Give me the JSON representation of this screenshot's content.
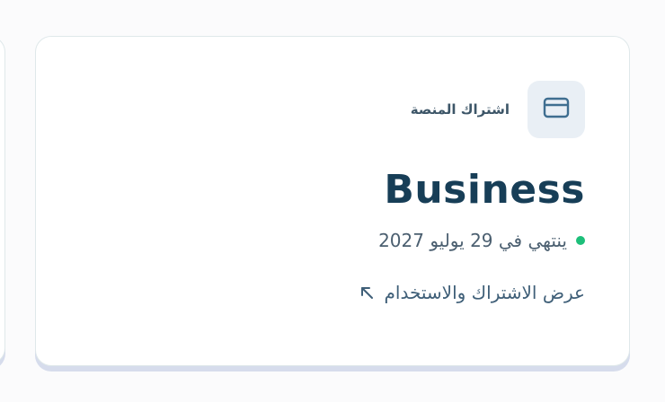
{
  "card": {
    "kicker": "اشتراك المنصة",
    "plan_name": "Business",
    "status_text": "ينتهي في 29 يوليو 2027",
    "status_color": "#1dbf7a",
    "link_text": "عرض الاشتراك والاستخدام"
  },
  "icons": {
    "card_icon": "credit-card-icon",
    "link_icon": "arrow-up-left-icon"
  },
  "colors": {
    "accent": "#173e57",
    "icon_tile_bg": "#e9eff5",
    "status_dot": "#1dbf7a"
  }
}
